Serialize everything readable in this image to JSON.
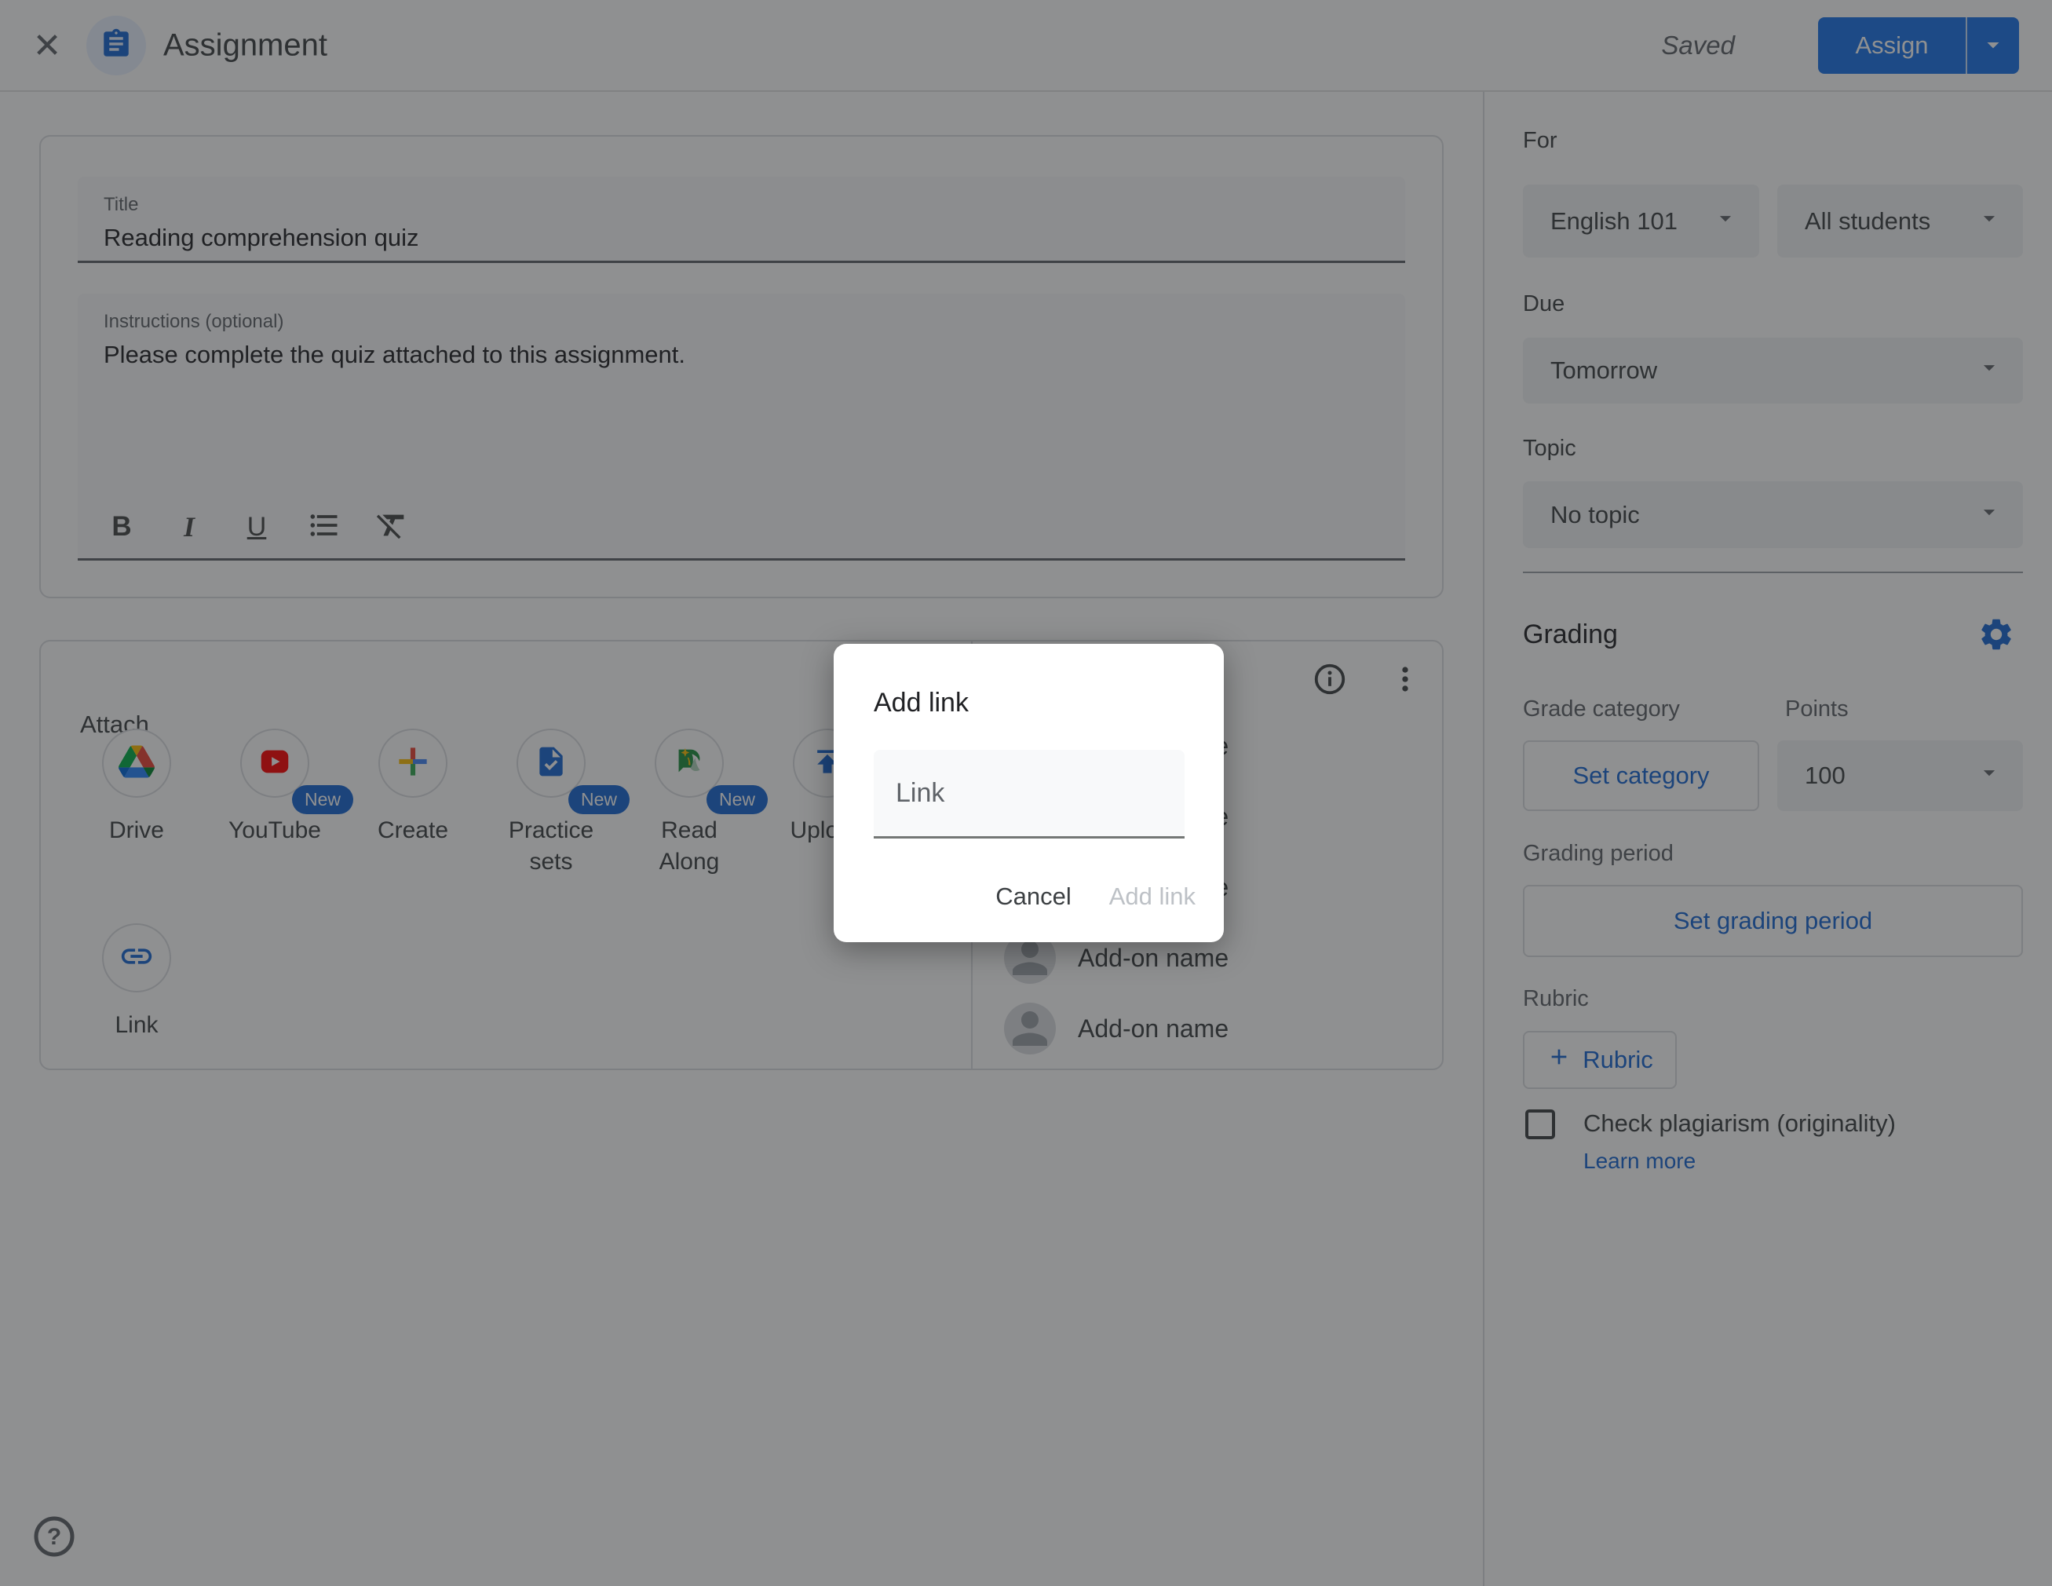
{
  "header": {
    "title": "Assignment",
    "saved_label": "Saved",
    "assign_label": "Assign"
  },
  "editor": {
    "title_field": {
      "label": "Title",
      "value": "Reading comprehension quiz"
    },
    "instructions_field": {
      "label": "Instructions (optional)",
      "value": "Please complete the quiz attached to this assignment."
    },
    "toolbar": {
      "bold": "B",
      "italic": "I",
      "underline": "U"
    }
  },
  "attach": {
    "label": "Attach",
    "options": [
      {
        "label": "Drive"
      },
      {
        "label": "YouTube",
        "badge": "New"
      },
      {
        "label": "Create"
      },
      {
        "label": "Practice sets",
        "badge": "New"
      },
      {
        "label": "Read Along",
        "badge": "New"
      },
      {
        "label": "Upload"
      },
      {
        "label": "Link"
      }
    ],
    "addons": [
      "Add-on name",
      "Add-on name",
      "Add-on name",
      "Add-on name",
      "Add-on name"
    ]
  },
  "modal": {
    "title": "Add link",
    "input_placeholder": "Link",
    "cancel_label": "Cancel",
    "submit_label": "Add link"
  },
  "sidebar": {
    "for_label": "For",
    "class_value": "English 101",
    "students_value": "All students",
    "due_label": "Due",
    "due_value": "Tomorrow",
    "topic_label": "Topic",
    "topic_value": "No topic",
    "grading_label": "Grading",
    "grade_category_label": "Grade category",
    "set_category_label": "Set category",
    "points_label": "Points",
    "points_value": "100",
    "grading_period_label": "Grading period",
    "set_grading_period_label": "Set grading period",
    "rubric_label": "Rubric",
    "add_rubric_label": "Rubric",
    "plagiarism_label": "Check plagiarism (originality)",
    "learn_more_label": "Learn more"
  },
  "colors": {
    "accent_blue": "#1a73e8",
    "link_blue": "#1967d2",
    "icon_circle_bg": "#e8f0fe",
    "chip_bg": "#f1f3f4",
    "field_bg": "#f8f9fa",
    "border": "#dadce0",
    "text_primary": "#202124",
    "text_secondary": "#5f6368",
    "scrim": "rgba(32,33,36,0.5)"
  }
}
